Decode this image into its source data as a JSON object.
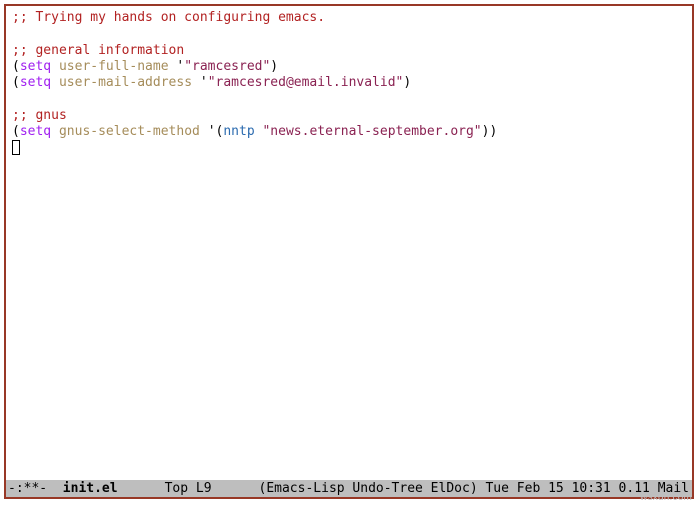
{
  "code": {
    "line1_comment": ";; Trying my hands on configuring emacs.",
    "line3_comment": ";; general information",
    "line4_keyword": "setq",
    "line4_var": "user-full-name",
    "line4_quote": "'",
    "line4_string": "\"ramcesred\"",
    "line5_keyword": "setq",
    "line5_var": "user-mail-address",
    "line5_quote": "'",
    "line5_string": "\"ramcesred@email.invalid\"",
    "line7_comment": ";; gnus",
    "line8_keyword": "setq",
    "line8_var": "gnus-select-method",
    "line8_quote": "'",
    "line8_builtin": "nntp",
    "line8_string": "\"news.eternal-september.org\""
  },
  "modeline": {
    "left": "-:**-  ",
    "buffer": "init.el",
    "gap1": "      ",
    "pos": "Top",
    "line": " L9",
    "gap2": "      ",
    "modes": "(Emacs-Lisp Undo-Tree ElDoc)",
    "gap3": " ",
    "time": "Tue Feb 15 10:31",
    "gap4": " ",
    "load": "0.11",
    "gap5": " ",
    "mail": "Mail"
  },
  "watermark": "wsxdn.com"
}
